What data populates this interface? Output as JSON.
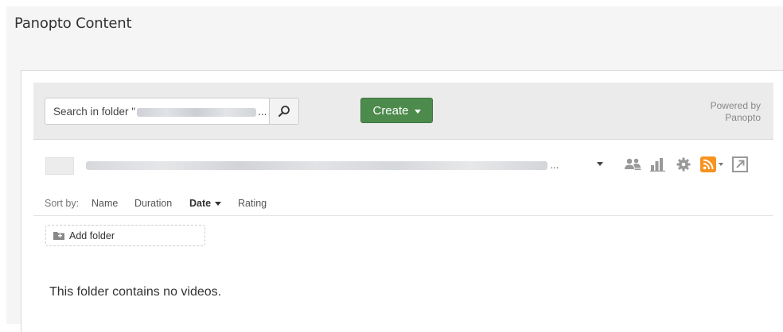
{
  "page": {
    "title": "Panopto Content"
  },
  "toolbar": {
    "search": {
      "prefix": "Search in folder \"",
      "suffix": "..."
    },
    "create_label": "Create",
    "powered_line1": "Powered by",
    "powered_line2": "Panopto"
  },
  "folder": {
    "name_suffix": "..."
  },
  "toolbar_icons": [
    "users-icon",
    "bar-chart-icon",
    "gear-icon",
    "rss-icon",
    "external-link-icon"
  ],
  "sort": {
    "label": "Sort by:",
    "options": [
      "Name",
      "Duration",
      "Date",
      "Rating"
    ],
    "active": "Date"
  },
  "add_folder_label": "Add folder",
  "empty_message": "This folder contains no videos.",
  "colors": {
    "create_button": "#4d8b4d",
    "rss": "#f7931e",
    "background": "#f5f5f5"
  }
}
